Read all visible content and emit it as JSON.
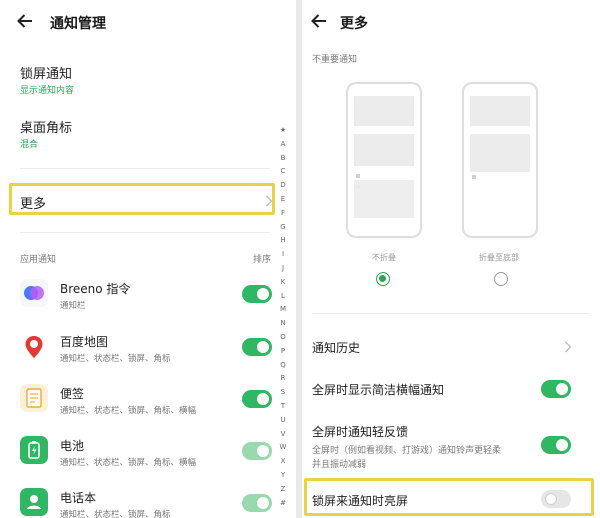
{
  "left": {
    "header": {
      "title": "通知管理"
    },
    "lockscreen": {
      "title": "锁屏通知",
      "value": "显示通知内容"
    },
    "badge": {
      "title": "桌面角标",
      "value": "混合"
    },
    "more": {
      "title": "更多"
    },
    "section": {
      "title": "应用通知",
      "sort_label": "排序"
    },
    "alphabet": [
      "★",
      "A",
      "B",
      "C",
      "D",
      "E",
      "F",
      "G",
      "H",
      "I",
      "J",
      "K",
      "L",
      "M",
      "N",
      "O",
      "P",
      "Q",
      "R",
      "S",
      "T",
      "U",
      "V",
      "W",
      "X",
      "Y",
      "Z",
      "#"
    ],
    "apps": [
      {
        "name": "Breeno 指令",
        "desc": "通知栏",
        "icon_color": "#6a6cf0",
        "toggle": "on"
      },
      {
        "name": "百度地图",
        "desc": "通知栏、状态栏、锁屏、角标",
        "icon_color": "#e53935",
        "toggle": "on"
      },
      {
        "name": "便签",
        "desc": "通知栏、状态栏、锁屏、角标、横幅",
        "icon_color": "#f2a93b",
        "toggle": "on"
      },
      {
        "name": "电池",
        "desc": "通知栏、状态栏、锁屏、角标、横幅",
        "icon_color": "#2fb763",
        "toggle": "faded"
      },
      {
        "name": "电话本",
        "desc": "通知栏、状态栏、锁屏、角标",
        "icon_color": "#2fb763",
        "toggle": "faded"
      }
    ]
  },
  "right": {
    "header": {
      "title": "更多"
    },
    "unimportant": {
      "title": "不重要通知",
      "options": [
        {
          "label": "不折叠",
          "selected": true
        },
        {
          "label": "折叠至底部",
          "selected": false
        }
      ]
    },
    "history": {
      "title": "通知历史"
    },
    "fullscreen_banner": {
      "title": "全屏时显示简洁横幅通知",
      "toggle": "on"
    },
    "fullscreen_feedback": {
      "title": "全屏时通知轻反馈",
      "desc_line1": "全屏时（例如看视频、打游戏）通知铃声更轻柔",
      "desc_line2": "并且振动减弱",
      "toggle": "on"
    },
    "lock_wake": {
      "title": "锁屏来通知时亮屏",
      "toggle": "off"
    }
  },
  "colors": {
    "accent": "#2fb763",
    "highlight": "#e7d24a"
  }
}
